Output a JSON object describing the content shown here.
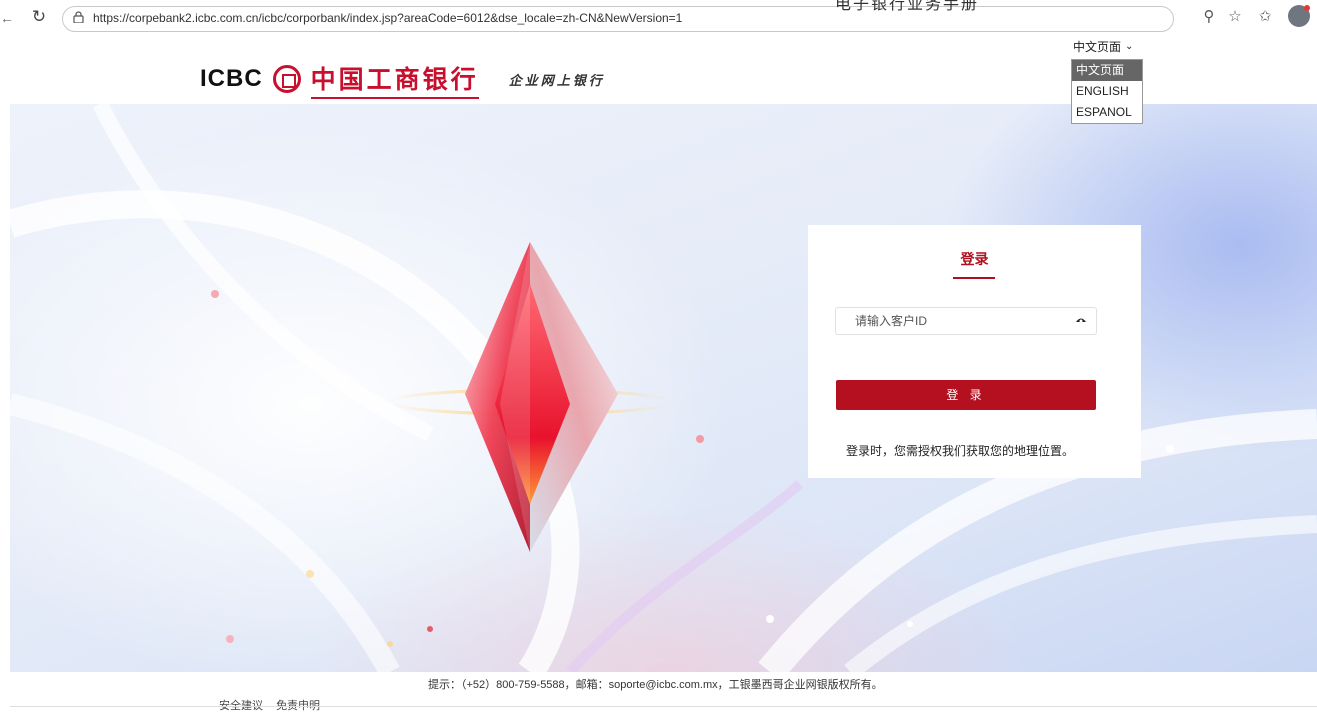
{
  "browser": {
    "url": "https://corpebank2.icbc.com.cn/icbc/corporbank/index.jsp?areaCode=6012&dse_locale=zh-CN&NewVersion=1"
  },
  "top_overlay_text": "电子银行业务手册",
  "header": {
    "logo_latin": "ICBC",
    "logo_cn": "中国工商银行",
    "logo_sub": "企业网上银行"
  },
  "language": {
    "selected": "中文页面",
    "options": [
      "中文页面",
      "ENGLISH",
      "ESPANOL"
    ]
  },
  "login": {
    "title": "登录",
    "customer_id_placeholder": "请输入客户ID",
    "button_label": "登 录",
    "note": "登录时，您需授权我们获取您的地理位置。"
  },
  "footer": {
    "tip": "提示：（+52）800-759-5588，邮箱：soporte@icbc.com.mx，工银墨西哥企业网银版权所有。",
    "links": [
      "安全建议",
      "免责申明"
    ]
  },
  "colors": {
    "brand_red": "#b10f1f"
  }
}
